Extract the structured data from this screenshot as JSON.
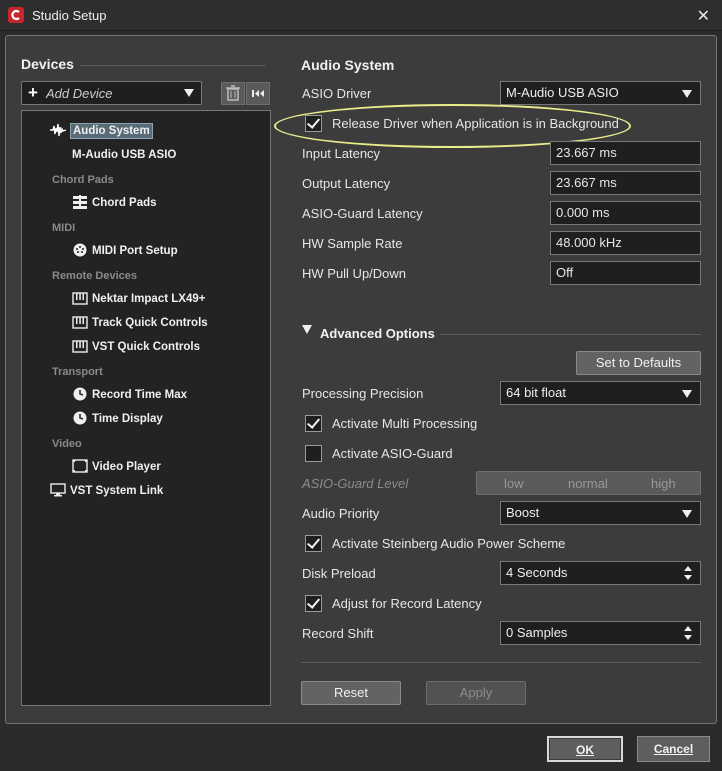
{
  "window": {
    "title": "Studio Setup",
    "close_glyph": "✕"
  },
  "left": {
    "header": "Devices",
    "add_device": "Add Device",
    "tree": [
      {
        "type": "item",
        "label": "Audio System",
        "icon": "audio-waveform-icon",
        "selected": true
      },
      {
        "type": "item",
        "label": "M-Audio USB ASIO",
        "icon": "",
        "selected": false
      },
      {
        "type": "category",
        "label": "Chord Pads"
      },
      {
        "type": "item",
        "label": "Chord Pads",
        "icon": "chord-pads-icon"
      },
      {
        "type": "category",
        "label": "MIDI"
      },
      {
        "type": "item",
        "label": "MIDI Port Setup",
        "icon": "midi-port-icon"
      },
      {
        "type": "category",
        "label": "Remote Devices"
      },
      {
        "type": "item",
        "label": "Nektar Impact LX49+",
        "icon": "remote-device-icon"
      },
      {
        "type": "item",
        "label": "Track Quick Controls",
        "icon": "remote-device-icon"
      },
      {
        "type": "item",
        "label": "VST Quick Controls",
        "icon": "remote-device-icon"
      },
      {
        "type": "category",
        "label": "Transport"
      },
      {
        "type": "item",
        "label": "Record Time Max",
        "icon": "clock-icon"
      },
      {
        "type": "item",
        "label": "Time Display",
        "icon": "clock-icon"
      },
      {
        "type": "category",
        "label": "Video"
      },
      {
        "type": "item",
        "label": "Video Player",
        "icon": "video-player-icon"
      },
      {
        "type": "item",
        "label": "VST System Link",
        "icon": "monitor-icon"
      }
    ]
  },
  "audio_system": {
    "header": "Audio System",
    "asio_driver_label": "ASIO Driver",
    "asio_driver_value": "M-Audio USB ASIO",
    "release_driver_label": "Release Driver when Application is in Background",
    "release_driver_checked": true,
    "input_latency_label": "Input Latency",
    "input_latency_value": "23.667 ms",
    "output_latency_label": "Output Latency",
    "output_latency_value": "23.667 ms",
    "asio_guard_latency_label": "ASIO-Guard Latency",
    "asio_guard_latency_value": "0.000 ms",
    "hw_sample_rate_label": "HW Sample Rate",
    "hw_sample_rate_value": "48.000 kHz",
    "hw_pull_label": "HW Pull Up/Down",
    "hw_pull_value": "Off"
  },
  "advanced": {
    "header": "Advanced Options",
    "set_defaults": "Set to Defaults",
    "processing_precision_label": "Processing Precision",
    "processing_precision_value": "64 bit float",
    "multi_processing_label": "Activate Multi Processing",
    "multi_processing_checked": true,
    "asio_guard_label": "Activate ASIO-Guard",
    "asio_guard_checked": false,
    "asio_guard_level_label": "ASIO-Guard Level",
    "asio_guard_levels": [
      "low",
      "normal",
      "high"
    ],
    "audio_priority_label": "Audio Priority",
    "audio_priority_value": "Boost",
    "power_scheme_label": "Activate Steinberg Audio Power Scheme",
    "power_scheme_checked": true,
    "disk_preload_label": "Disk Preload",
    "disk_preload_value": "4 Seconds",
    "adjust_latency_label": "Adjust for Record Latency",
    "adjust_latency_checked": true,
    "record_shift_label": "Record Shift",
    "record_shift_value": "0 Samples"
  },
  "actions": {
    "reset": "Reset",
    "apply": "Apply",
    "ok": "OK",
    "cancel": "Cancel"
  },
  "colors": {
    "background": "#3c3c3c",
    "field": "#1f1f1f",
    "highlight_ellipse": "#e9ec8a",
    "app_icon": "#c8262f"
  }
}
